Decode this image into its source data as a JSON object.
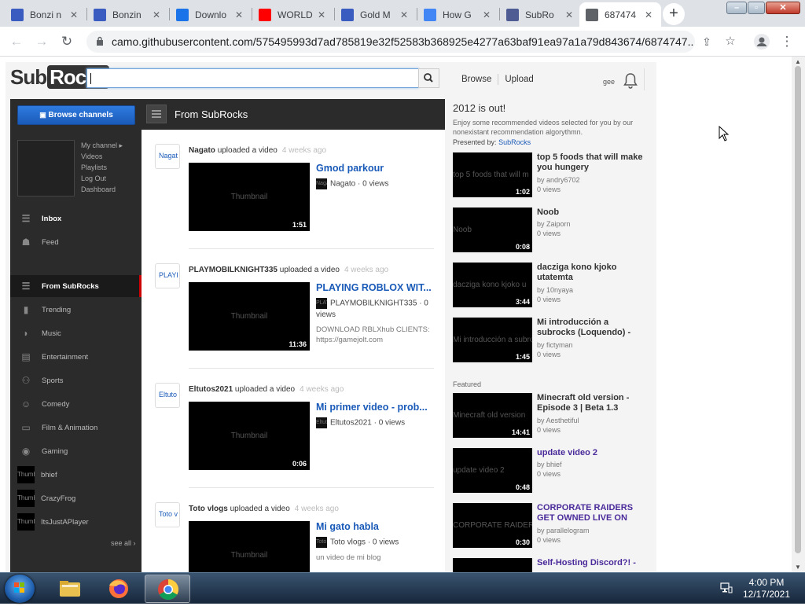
{
  "browser": {
    "tabs": [
      {
        "title": "Bonzi n",
        "icon": "bonzi-icon",
        "color": "#3a5bbf"
      },
      {
        "title": "Bonzin",
        "icon": "bonzi-icon",
        "color": "#3a5bbf"
      },
      {
        "title": "Downlo",
        "icon": "download-icon",
        "color": "#1a73e8"
      },
      {
        "title": "WORLD",
        "icon": "youtube-icon",
        "color": "#ff0000"
      },
      {
        "title": "Gold M",
        "icon": "bonzi-icon",
        "color": "#3a5bbf"
      },
      {
        "title": "How G",
        "icon": "google-icon",
        "color": "#4285f4"
      },
      {
        "title": "SubRo",
        "icon": "php-icon",
        "color": "#4f5b93"
      },
      {
        "title": "687474",
        "icon": "globe-icon",
        "color": "#5f6368"
      }
    ],
    "url": "camo.githubusercontent.com/575495993d7ad785819e32f52583b368925e4277a63baf91ea97a1a79d843674/6874747..."
  },
  "site": {
    "logo_a": "Sub",
    "logo_b": "Rocks",
    "search_value": "",
    "browse": "Browse",
    "upload": "Upload",
    "username": "gee"
  },
  "guide": {
    "browse_channels": "Browse channels",
    "my_links": [
      "My channel ▸",
      "Videos",
      "Playlists",
      "Log Out",
      "Dashboard"
    ],
    "inbox": "Inbox",
    "feed": "Feed",
    "categories": [
      "From SubRocks",
      "Trending",
      "Music",
      "Entertainment",
      "Sports",
      "Comedy",
      "Film & Animation",
      "Gaming"
    ],
    "subscriptions": [
      {
        "name": "bhief",
        "thumb": "Thumb"
      },
      {
        "name": "CrazyFrog",
        "thumb": "Thumb"
      },
      {
        "name": "ItsJustAPlayer",
        "thumb": "Thumb"
      }
    ],
    "see_all": "see all ›"
  },
  "feed": {
    "title": "From SubRocks",
    "uploaded_text": "uploaded a video",
    "thumb_text": "Thumbnail",
    "views_text": "· 0 views",
    "items": [
      {
        "user": "Nagato",
        "avatar": "Nagat",
        "ago": "4 weeks ago",
        "title": "Gmod parkour",
        "duration": "1:51",
        "channel": "Nagato",
        "desc": ""
      },
      {
        "user": "PLAYMOBILKNIGHT335",
        "avatar": "PLAYI",
        "ago": "4 weeks ago",
        "title": "PLAYING ROBLOX WIT...",
        "duration": "11:36",
        "channel": "PLAYMOBILKNIGHT335",
        "desc": "DOWNLOAD RBLXhub CLIENTS: https://gamejolt.com"
      },
      {
        "user": "Eltutos2021",
        "avatar": "Eltuto",
        "ago": "4 weeks ago",
        "title": "Mi primer video - prob...",
        "duration": "0:06",
        "channel": "Eltutos2021",
        "desc": ""
      },
      {
        "user": "Toto vlogs",
        "avatar": "Toto v",
        "ago": "4 weeks ago",
        "title": "Mi gato habla",
        "duration": "",
        "channel": "Toto vlogs",
        "desc": "un video de mi blog"
      }
    ]
  },
  "recommended": {
    "title": "2012 is out!",
    "description": "Enjoy some recommended videos selected for you by our nonexistant recommendation algorythmn.",
    "presented_by": "Presented by:",
    "presented_link": "SubRocks",
    "featured_label": "Featured",
    "views": "0 views",
    "items": [
      {
        "title": "top 5 foods that will make you hungery",
        "by": "by andry6702",
        "duration": "1:02",
        "thumb": "top 5 foods that will m",
        "link": false
      },
      {
        "title": "Noob",
        "by": "by Zaiporn",
        "duration": "0:08",
        "thumb": "Noob",
        "link": false
      },
      {
        "title": "dacziga kono kjoko utatemta",
        "by": "by 10nyaya",
        "duration": "3:44",
        "thumb": "dacziga kono kjoko u",
        "link": false
      },
      {
        "title": "Mi introducción a subrocks (Loquendo) -",
        "by": "by fictyman",
        "duration": "1:45",
        "thumb": "Mi introducción a subro",
        "link": false
      }
    ],
    "featured": [
      {
        "title": "Minecraft old version - Episode 3 | Beta 1.3",
        "by": "by Aesthetiful",
        "duration": "14:41",
        "thumb": "Minecraft old version",
        "link": false
      },
      {
        "title": "update video 2",
        "by": "by bhief",
        "duration": "0:48",
        "thumb": "update video 2",
        "link": true
      },
      {
        "title": "CORPORATE RAIDERS GET OWNED LIVE ON",
        "by": "by parallelogram",
        "duration": "0:30",
        "thumb": "CORPORATE RAIDERS",
        "link": true
      },
      {
        "title": "Self-Hosting Discord?! -",
        "by": "",
        "duration": "",
        "thumb": "",
        "link": true
      }
    ]
  },
  "taskbar": {
    "time": "4:00 PM",
    "date": "12/17/2021"
  }
}
